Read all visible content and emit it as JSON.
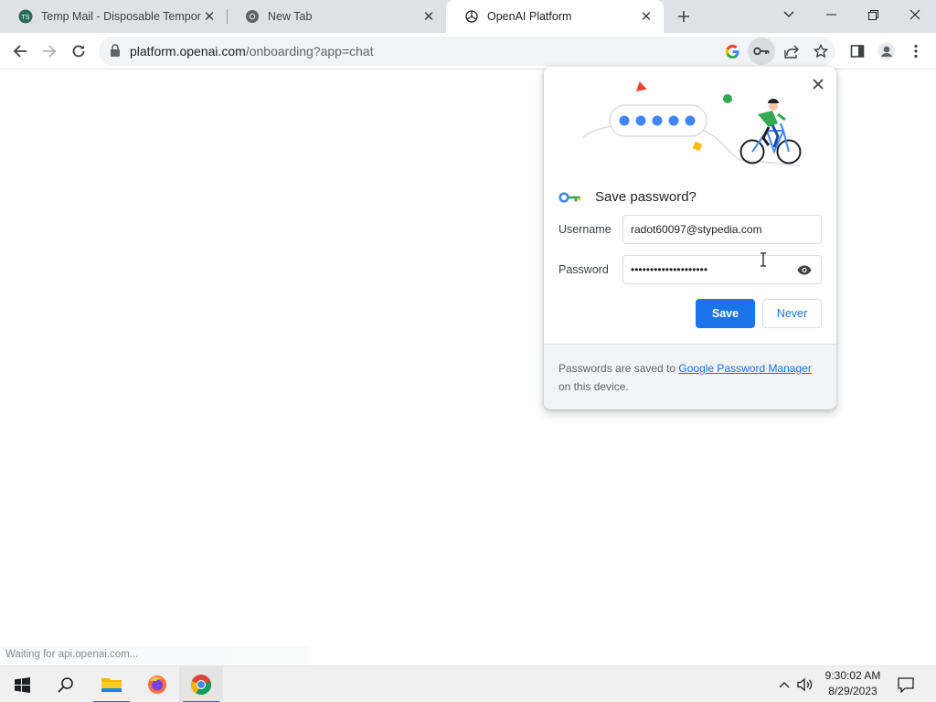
{
  "browser": {
    "tabs": [
      {
        "title": "Temp Mail - Disposable Tempora",
        "active": false,
        "favicon": "tempmail-icon"
      },
      {
        "title": "New Tab",
        "active": false,
        "favicon": "chrome-icon"
      },
      {
        "title": "OpenAI Platform",
        "active": true,
        "favicon": "openai-icon"
      }
    ],
    "url_host": "platform.openai.com",
    "url_path": "/onboarding?app=chat",
    "status_text": "Waiting for api.openai.com..."
  },
  "save_password": {
    "heading": "Save password?",
    "username_label": "Username",
    "username_value": "radot60097@stypedia.com",
    "password_label": "Password",
    "password_value": "••••••••••••••••••••",
    "save_label": "Save",
    "never_label": "Never",
    "footer_prefix": "Passwords are saved to ",
    "footer_link": "Google Password Manager",
    "footer_suffix": " on this device."
  },
  "taskbar": {
    "time": "9:30:02 AM",
    "date": "8/29/2023",
    "apps": [
      "file-explorer-icon",
      "firefox-icon",
      "chrome-icon"
    ]
  },
  "colors": {
    "accent": "#1a73e8",
    "tabstrip": "#dee1e6",
    "omnibox": "#f1f3f4"
  }
}
